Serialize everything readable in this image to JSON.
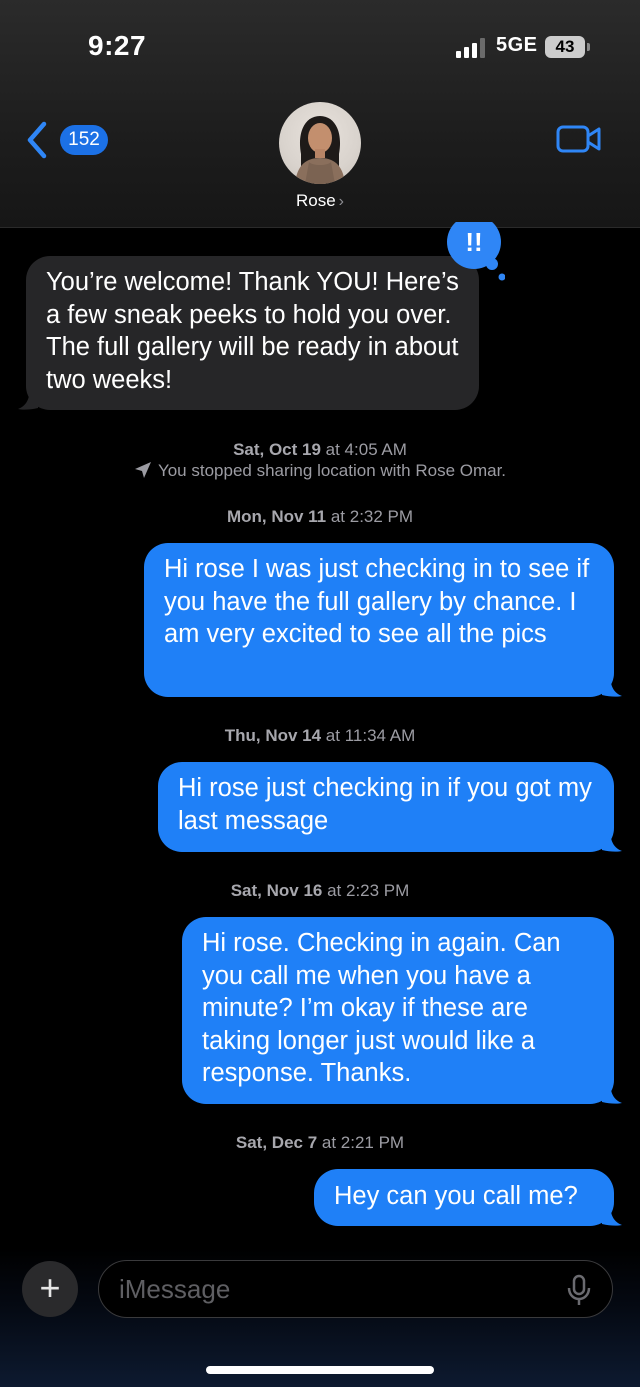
{
  "status_bar": {
    "time": "9:27",
    "network": "5GE",
    "battery": "43"
  },
  "header": {
    "back_badge": "152",
    "contact_name": "Rose",
    "contact_chevron": "›"
  },
  "messages": [
    {
      "direction": "incoming",
      "text": "You’re welcome! Thank YOU! Here’s a few sneak peeks to hold you over. The full gallery will be ready in about two weeks!"
    },
    {
      "direction": "outgoing",
      "text": "Hi rose I was just checking in to see if you have the full gallery by chance. I am very excited to see all the pics"
    },
    {
      "direction": "outgoing",
      "text": "Hi rose just checking in if you got my last message"
    },
    {
      "direction": "outgoing",
      "text": "Hi rose. Checking in again. Can you call me when you have a minute? I’m okay if these are taking longer just would like a response. Thanks."
    },
    {
      "direction": "outgoing",
      "text": "Hey can you call me?"
    }
  ],
  "timestamps": [
    {
      "day": "Sat, Oct 19",
      "time": " at 4:05 AM"
    },
    {
      "day": "Mon, Nov 11",
      "time": " at 2:32 PM"
    },
    {
      "day": "Thu, Nov 14",
      "time": " at 11:34 AM"
    },
    {
      "day": "Sat, Nov 16",
      "time": " at 2:23 PM"
    },
    {
      "day": "Sat, Dec 7",
      "time": " at 2:21 PM"
    }
  ],
  "system_note": "You stopped sharing location with Rose Omar.",
  "reaction": {
    "icon": "exclamation-tapback-icon",
    "glyph": "!!"
  },
  "composer": {
    "placeholder": "iMessage",
    "plus": "+"
  },
  "colors": {
    "outgoing": "#1f80f7",
    "incoming": "#262628",
    "accent": "#1c71e6"
  }
}
